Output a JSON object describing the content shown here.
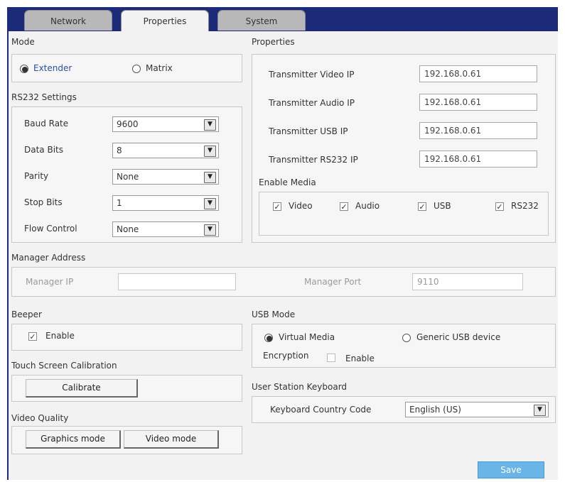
{
  "tabs": [
    {
      "label": "Network"
    },
    {
      "label": "Properties"
    },
    {
      "label": "System"
    }
  ],
  "mode": {
    "title": "Mode",
    "options": [
      {
        "label": "Extender",
        "selected": true
      },
      {
        "label": "Matrix",
        "selected": false
      }
    ]
  },
  "rs232": {
    "title": "RS232 Settings",
    "fields": [
      {
        "label": "Baud Rate",
        "value": "9600"
      },
      {
        "label": "Data Bits",
        "value": "8"
      },
      {
        "label": "Parity",
        "value": "None"
      },
      {
        "label": "Stop Bits",
        "value": "1"
      },
      {
        "label": "Flow Control",
        "value": "None"
      }
    ]
  },
  "properties": {
    "title": "Properties",
    "fields": [
      {
        "label": "Transmitter Video IP",
        "value": "192.168.0.61"
      },
      {
        "label": "Transmitter Audio IP",
        "value": "192.168.0.61"
      },
      {
        "label": "Transmitter USB IP",
        "value": "192.168.0.61"
      },
      {
        "label": "Transmitter RS232 IP",
        "value": "192.168.0.61"
      }
    ]
  },
  "enable_media": {
    "title": "Enable Media",
    "items": [
      {
        "label": "Video",
        "checked": true
      },
      {
        "label": "Audio",
        "checked": true
      },
      {
        "label": "USB",
        "checked": true
      },
      {
        "label": "RS232",
        "checked": true
      }
    ]
  },
  "manager": {
    "title": "Manager Address",
    "ip_label": "Manager IP",
    "ip_value": "",
    "port_label": "Manager Port",
    "port_value": "9110"
  },
  "beeper": {
    "title": "Beeper",
    "enable_label": "Enable",
    "checked": true
  },
  "usb_mode": {
    "title": "USB Mode",
    "options": [
      {
        "label": "Virtual Media",
        "selected": true
      },
      {
        "label": "Generic USB device",
        "selected": false
      }
    ],
    "encryption_label": "Encryption",
    "encryption_enable_label": "Enable",
    "encryption_checked": false
  },
  "touch": {
    "title": "Touch Screen Calibration",
    "button": "Calibrate"
  },
  "keyboard": {
    "title": "User Station Keyboard",
    "label": "Keyboard Country Code",
    "value": "English (US)"
  },
  "video_quality": {
    "title": "Video Quality",
    "buttons": [
      "Graphics mode",
      "Video mode"
    ]
  },
  "save_label": "Save",
  "colors": {
    "titlebar": "#1b2b7a",
    "save": "#6ab5e8",
    "panel": "#f2f2f2"
  }
}
